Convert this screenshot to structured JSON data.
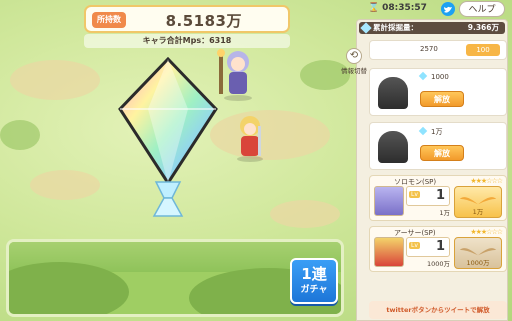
{
  "counter": {
    "tag": "所持数",
    "value": "8.5183万"
  },
  "mps": {
    "text": "キャラ合計Mps：6318"
  },
  "gacha": {
    "line1": "1連",
    "line2": "ガチャ"
  },
  "status": {
    "timer_icon": "hourglass-icon",
    "timer": "08:35:57",
    "twitter_icon": "twitter-icon",
    "help_label": "ヘルプ"
  },
  "panel": {
    "cumulative_label": "累計採掘量：",
    "cumulative_value": "9.366万",
    "top_costs": [
      "2570",
      "100"
    ],
    "info_toggle_label": "情報切替",
    "locked": [
      {
        "price": "1000",
        "button": "解放"
      },
      {
        "price": "1万",
        "button": "解放"
      }
    ],
    "units": [
      {
        "name": "ソロモン(SP)",
        "stars": "★★★☆☆☆",
        "level_tag": "Lv",
        "level": "1",
        "cost": "1万",
        "upgrade_cost": "1万"
      },
      {
        "name": "アーサー(SP)",
        "stars": "★★★☆☆☆",
        "level_tag": "Lv",
        "level": "1",
        "cost": "1000万",
        "upgrade_cost": "1000万"
      }
    ],
    "twitter_note": "twitterボタンからツイートで解放"
  },
  "colors": {
    "accent": "#f08a4b",
    "gacha_blue": "#1d76d8",
    "panel_bg": "#f4efe0"
  }
}
